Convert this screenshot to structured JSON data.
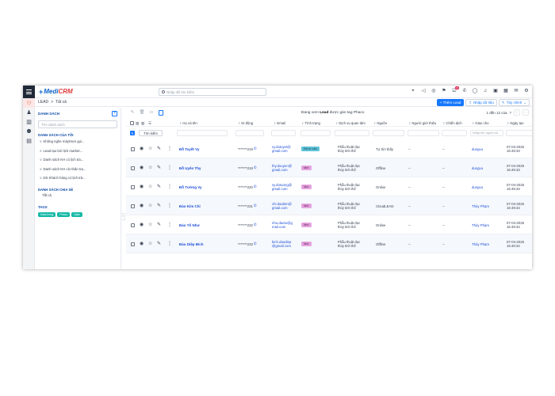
{
  "app": {
    "logo_mark": "+",
    "logo_text_prefix": "Medi",
    "logo_text_suffix": "CRM",
    "search_placeholder": "Nhập để tìm kiếm",
    "notification_count": "15"
  },
  "breadcrumb": {
    "root": "LEAD",
    "separator": ">",
    "current": "Tất cả"
  },
  "actions": {
    "add_lead": "+ Thêm Lead",
    "import": "Nhập dữ liệu",
    "customize": "Tùy chỉnh"
  },
  "sidebar": {
    "title": "DANH SÁCH",
    "plus": "+",
    "search_placeholder": "Tìm danh sách",
    "my_lists_title": "DANH SÁCH CỦA TÔI",
    "my_lists": [
      "Không nghe máy/Hẹn gọi...",
      "Lead tạo bởi lịch market...",
      "Danh sách KH có lịch tra...",
      "Danh sách KH cả nhân tra...",
      "DS Khách hàng có lịch trả..."
    ],
    "shared_title": "DANH SÁCH CHIA SẺ",
    "shared_items": [
      "Tất cả"
    ],
    "tags_title": "TAGS",
    "tags": [
      {
        "label": "Data trùng",
        "color": "#14b8a6"
      },
      {
        "label": "Phaco",
        "color": "#14b8a6"
      },
      {
        "label": "Djeln",
        "color": "#14b8a6"
      }
    ]
  },
  "toolbar": {
    "filter_prefix": "Đang xem ",
    "filter_bold": "Lead",
    "filter_suffix": " được gán tag Phaco",
    "pagination": "1 đến 12 của",
    "pagination_help": "?"
  },
  "table": {
    "search_button": "Tìm kiếm",
    "assignee_filter_placeholder": "Nhập tên người dù",
    "columns": [
      "Họ và tên",
      "Di động",
      "Email",
      "Tình trạng",
      "Dịch vụ quan tâm",
      "Nguồn",
      "Người giới thiệu",
      "Chiến dịch",
      "Giao cho",
      "Ngày tạo",
      "Lý do"
    ],
    "rows": [
      {
        "name": "Đỗ Tuyết Vy",
        "phone": "*******219",
        "email": [
          "vy.dotuyet@",
          "gmail.com"
        ],
        "status": "Đã tư vấn",
        "status_bg": "#5ec3d8",
        "status_fg": "#0f3a4a",
        "service": [
          "Phẫu thuật đục",
          "thủy tinh thể"
        ],
        "source": "Tự tìm thấy",
        "referrer": "--",
        "campaign": "--",
        "assignee": "dungvu",
        "created": "07-04-2025 16:49:33"
      },
      {
        "name": "Đỗ Uyên Thy",
        "phone": "*******218",
        "email": [
          "thy.douyen@",
          "gmail.com"
        ],
        "status": "Mới",
        "status_bg": "#e6a3e0",
        "status_fg": "#4a1545",
        "service": [
          "Phẫu thuật đục",
          "thủy tinh thể"
        ],
        "source": "Offline",
        "referrer": "--",
        "campaign": "--",
        "assignee": "dungvu",
        "created": "07-04-2025 16:49:33"
      },
      {
        "name": "Đỗ Tường Vy",
        "phone": "*******220",
        "email": [
          "vy.dotuong@",
          "gmail.com"
        ],
        "status": "Mới",
        "status_bg": "#e6a3e0",
        "status_fg": "#4a1545",
        "service": [
          "Phẫu thuật đục",
          "thủy tinh thể"
        ],
        "source": "Online",
        "referrer": "--",
        "campaign": "--",
        "assignee": "dungvu",
        "created": "07-04-2025 16:49:33"
      },
      {
        "name": "Đào Kim Chi",
        "phone": "*******231",
        "email": [
          "chi.daokim@",
          "gmail.com"
        ],
        "status": "Mới",
        "status_bg": "#e6a3e0",
        "status_fg": "#4a1545",
        "service": [
          "Phẫu thuật đục",
          "thủy tinh thể"
        ],
        "source": "CloudLEAD",
        "referrer": "--",
        "campaign": "--",
        "assignee": "Thủy Phạm",
        "created": "07-04-2025 16:49:34"
      },
      {
        "name": "Đào Tố Như",
        "phone": "*******232",
        "email": [
          "nhu.daoto@g",
          "mail.com"
        ],
        "status": "Mới",
        "status_bg": "#e6a3e0",
        "status_fg": "#4a1545",
        "service": [
          "Phẫu thuật đục",
          "thủy tinh thể"
        ],
        "source": "Online",
        "referrer": "--",
        "campaign": "--",
        "assignee": "Thủy Phạm",
        "created": "07-04-2025 16:49:34"
      },
      {
        "name": "Đào Diệp Bích",
        "phone": "*******233",
        "email": [
          "bich.daodiep",
          "@gmail.com"
        ],
        "status": "Mới",
        "status_bg": "#e6a3e0",
        "status_fg": "#4a1545",
        "service": [
          "Phẫu thuật đục",
          "thủy tinh thể"
        ],
        "source": "Offline",
        "referrer": "--",
        "campaign": "--",
        "assignee": "Thủy Phạm",
        "created": "07-04-2025 16:49:34"
      }
    ]
  },
  "colors": {
    "primary": "#1677ff",
    "header_bg": "#1f2937",
    "rail_active": "#e85d3f"
  }
}
